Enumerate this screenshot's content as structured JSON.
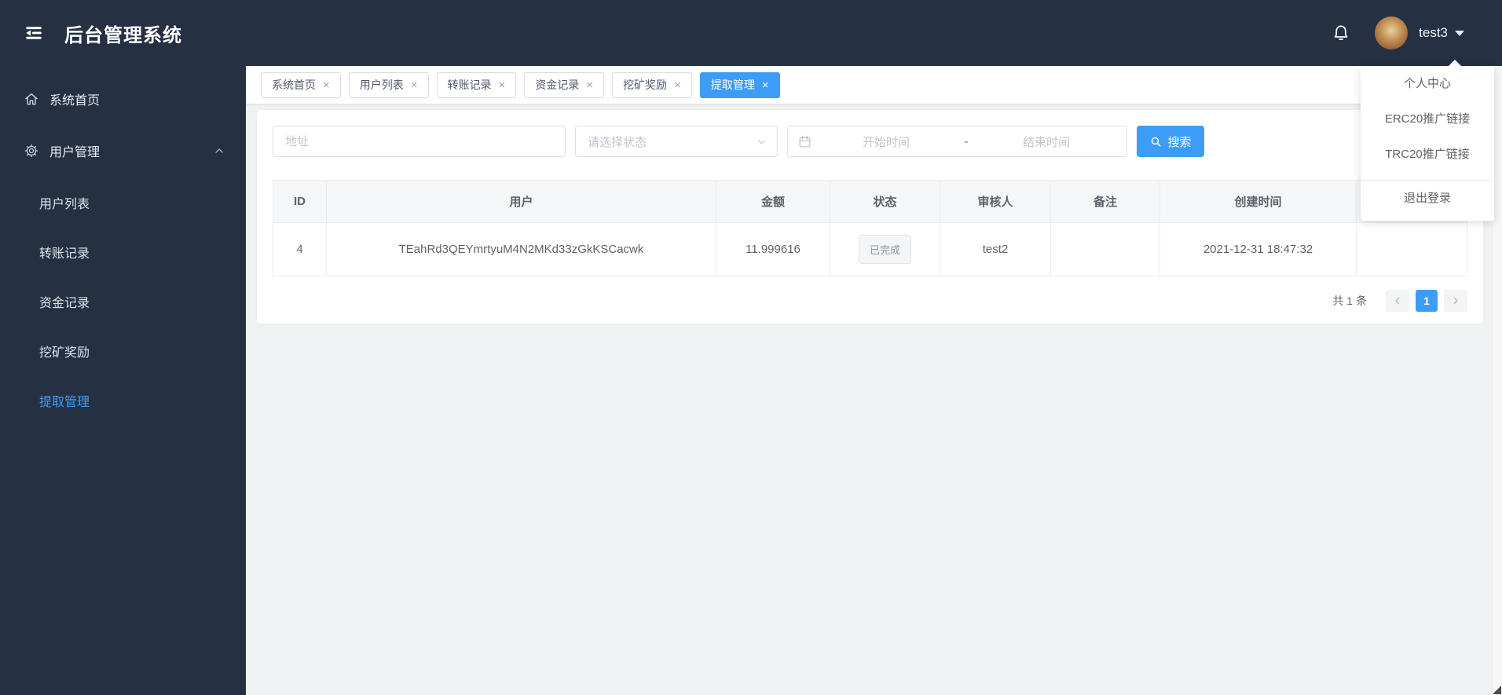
{
  "header": {
    "title": "后台管理系统",
    "username": "test3"
  },
  "sidebar": {
    "home": "系统首页",
    "group": "用户管理",
    "subitems": [
      "用户列表",
      "转账记录",
      "资金记录",
      "挖矿奖励",
      "提取管理"
    ]
  },
  "tabs": {
    "close": "×",
    "labels": [
      "系统首页",
      "用户列表",
      "转账记录",
      "资金记录",
      "挖矿奖励",
      "提取管理"
    ]
  },
  "filters": {
    "address_placeholder": "地址",
    "status_placeholder": "请选择状态",
    "start_placeholder": "开始时间",
    "range_separator": "-",
    "end_placeholder": "结束时间",
    "search_label": "搜索"
  },
  "table": {
    "columns": [
      "ID",
      "用户",
      "金额",
      "状态",
      "审核人",
      "备注",
      "创建时间",
      ""
    ],
    "row": {
      "id": "4",
      "user": "TEahRd3QEYmrtyuM4N2MKd33zGkKSCacwk",
      "amount": "11.999616",
      "status": "已完成",
      "reviewer": "test2",
      "remark": "",
      "created": "2021-12-31 18:47:32",
      "action": ""
    }
  },
  "pagination": {
    "total": "共 1 条",
    "page": "1"
  },
  "user_menu": {
    "items": [
      "个人中心",
      "ERC20推广链接",
      "TRC20推广链接",
      "退出登录"
    ]
  },
  "colors": {
    "accent": "#3d9df6",
    "dark": "#253043",
    "page_bg": "#f0f1f2"
  }
}
